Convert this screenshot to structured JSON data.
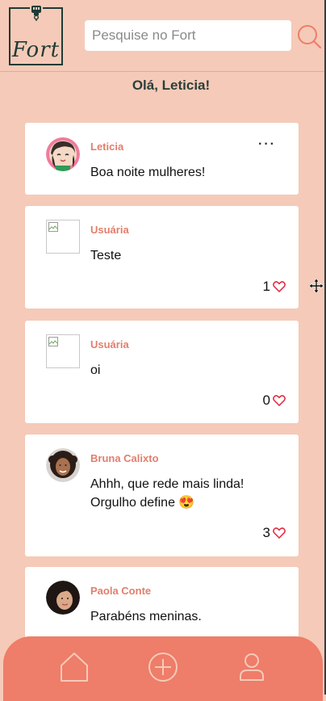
{
  "header": {
    "logo_text": "Fort",
    "search_placeholder": "Pesquise no Fort"
  },
  "greeting": "Olá, Leticia!",
  "posts": [
    {
      "author": "Leticia",
      "content": "Boa noite mulheres!",
      "has_menu": true
    },
    {
      "author": "Usuária",
      "content": "Teste",
      "likes": "1"
    },
    {
      "author": "Usuária",
      "content": "oi",
      "likes": "0"
    },
    {
      "author": "Bruna Calixto",
      "content": "Ahhh, que rede mais linda! Orgulho define 😍",
      "likes": "3"
    },
    {
      "author": "Paola Conte",
      "content": "Parabéns meninas."
    }
  ],
  "bottom_nav": {
    "items": [
      "home-icon",
      "add-post-icon",
      "profile-icon"
    ]
  },
  "colors": {
    "background": "#f6cab8",
    "accent": "#ee7d69",
    "author": "#e27e6c",
    "logo": "#1f3b33"
  }
}
